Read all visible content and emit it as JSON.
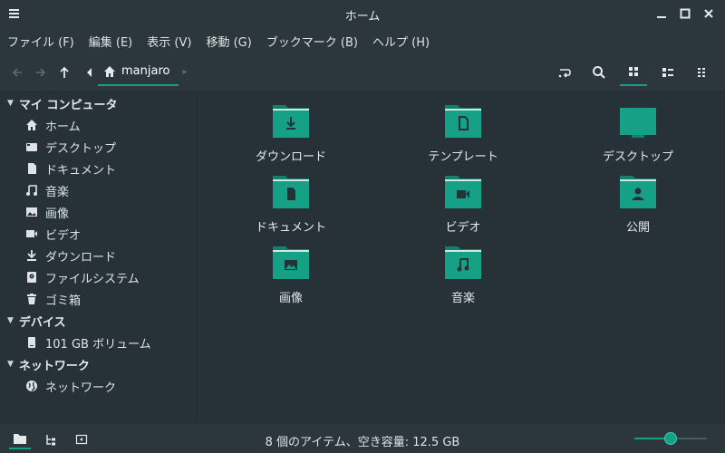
{
  "window": {
    "title": "ホーム"
  },
  "menubar": [
    "ファイル (F)",
    "編集 (E)",
    "表示 (V)",
    "移動 (G)",
    "ブックマーク (B)",
    "ヘルプ (H)"
  ],
  "toolbar": {
    "breadcrumb": "manjaro"
  },
  "sidebar": {
    "sections": [
      {
        "title": "マイ コンピュータ",
        "items": [
          {
            "label": "ホーム",
            "icon": "home-icon"
          },
          {
            "label": "デスクトップ",
            "icon": "desktop-icon"
          },
          {
            "label": "ドキュメント",
            "icon": "document-icon"
          },
          {
            "label": "音楽",
            "icon": "music-icon"
          },
          {
            "label": "画像",
            "icon": "image-icon"
          },
          {
            "label": "ビデオ",
            "icon": "video-icon"
          },
          {
            "label": "ダウンロード",
            "icon": "download-icon"
          },
          {
            "label": "ファイルシステム",
            "icon": "filesystem-icon"
          },
          {
            "label": "ゴミ箱",
            "icon": "trash-icon"
          }
        ]
      },
      {
        "title": "デバイス",
        "items": [
          {
            "label": "101 GB ボリューム",
            "icon": "drive-icon"
          }
        ]
      },
      {
        "title": "ネットワーク",
        "items": [
          {
            "label": "ネットワーク",
            "icon": "network-icon"
          }
        ]
      }
    ]
  },
  "files": [
    {
      "label": "ダウンロード",
      "icon": "folder-download-icon"
    },
    {
      "label": "テンプレート",
      "icon": "folder-templates-icon"
    },
    {
      "label": "デスクトップ",
      "icon": "folder-desktop-icon"
    },
    {
      "label": "ドキュメント",
      "icon": "folder-documents-icon"
    },
    {
      "label": "ビデオ",
      "icon": "folder-videos-icon"
    },
    {
      "label": "公開",
      "icon": "folder-public-icon"
    },
    {
      "label": "画像",
      "icon": "folder-pictures-icon"
    },
    {
      "label": "音楽",
      "icon": "folder-music-icon"
    }
  ],
  "statusbar": {
    "text": "8 個のアイテム、空き容量: 12.5 GB",
    "zoom_level": 0.5
  },
  "colors": {
    "accent": "#16a085",
    "background": "#263238",
    "panel": "#2b373d",
    "folder": "#16a085"
  }
}
